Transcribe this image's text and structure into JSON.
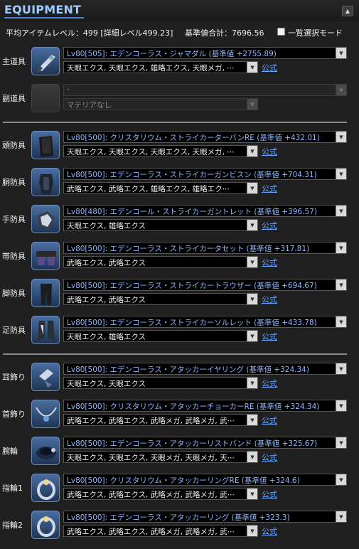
{
  "header": {
    "title": "EQUIPMENT",
    "collapse_glyph": "▲"
  },
  "summary": {
    "avg_level": "平均アイテムレベル：499 [詳細レベル499.23]",
    "total": "基準値合計：7696.56",
    "mode_label": "一覧選択モード",
    "mode_checked": false
  },
  "formal_label": "公式",
  "slots": [
    {
      "label": "主道具",
      "icon": "weapon-gunblade-icon",
      "item": "Lv80[505]: エデンコーラス・ジャマダル (基準値 +2755.89)",
      "materia": "天眼エクス, 天眼エクス, 雄略エクス, 天眼メガ, ⋯",
      "formal": true,
      "disabled": false
    },
    {
      "label": "副道具",
      "icon": "empty-slot-icon",
      "item": "-",
      "materia": "マテリアなし",
      "formal": false,
      "disabled": true
    },
    {
      "label": "頭防具",
      "icon": "head-armor-icon",
      "item": "Lv80[500]: クリスタリウム・ストライカーターバンRE (基準値 +432.01)",
      "materia": "天眼エクス, 天眼エクス, 天眼エクス, 天眼メガ, ⋯",
      "formal": true,
      "disabled": false
    },
    {
      "label": "胴防具",
      "icon": "body-armor-icon",
      "item": "Lv80[500]: エデンコーラス・ストライカーガンビスン (基準値 +704.31)",
      "materia": "武略エクス, 武略エクス, 雄略エクス, 雄略エク⋯",
      "formal": true,
      "disabled": false
    },
    {
      "label": "手防具",
      "icon": "hand-armor-icon",
      "item": "Lv80[480]: エデンコール・ストライカーガントレット (基準値 +396.57)",
      "materia": "天眼エクス, 雄略エクス",
      "formal": true,
      "disabled": false
    },
    {
      "label": "帯防具",
      "icon": "waist-armor-icon",
      "item": "Lv80[500]: エデンコーラス・ストライカータセット (基準値 +317.81)",
      "materia": "武略エクス, 武略エクス",
      "formal": true,
      "disabled": false
    },
    {
      "label": "脚防具",
      "icon": "leg-armor-icon",
      "item": "Lv80[500]: エデンコーラス・ストライカートラウザー (基準値 +694.67)",
      "materia": "武略エクス, 武略エクス",
      "formal": true,
      "disabled": false
    },
    {
      "label": "足防具",
      "icon": "feet-armor-icon",
      "item": "Lv80[500]: エデンコーラス・ストライカーソルレット (基準値 +433.78)",
      "materia": "天眼エクス, 雄略エクス",
      "formal": true,
      "disabled": false
    },
    {
      "label": "耳飾り",
      "icon": "earring-icon",
      "item": "Lv80[500]: エデンコーラス・アタッカーイヤリング (基準値 +324.34)",
      "materia": "天眼エクス, 天眼エクス",
      "formal": true,
      "disabled": false
    },
    {
      "label": "首飾り",
      "icon": "necklace-icon",
      "item": "Lv80[500]: クリスタリウム・アタッカーチョーカーRE (基準値 +324.34)",
      "materia": "武略エクス, 武略エクス, 武略メガ, 武略メガ, 武⋯",
      "formal": true,
      "disabled": false
    },
    {
      "label": "腕輪",
      "icon": "bracelet-icon",
      "item": "Lv80[500]: エデンコーラス・アタッカーリストバンド (基準値 +325.67)",
      "materia": "天眼エクス, 天眼エクス, 天眼メガ, 天眼メガ, 天⋯",
      "formal": true,
      "disabled": false
    },
    {
      "label": "指輪1",
      "icon": "ring-icon",
      "item": "Lv80[500]: クリスタリウム・アタッカーリングRE (基準値 +324.6)",
      "materia": "武略エクス, 武略エクス, 武略メガ, 武略メガ, 武⋯",
      "formal": true,
      "disabled": false
    },
    {
      "label": "指輪2",
      "icon": "ring-icon",
      "item": "Lv80[500]: エデンコーラス・アタッカーリング (基準値 +323.3)",
      "materia": "武略エクス, 武略エクス, 武略メガ, 武略メガ, 武⋯",
      "formal": true,
      "disabled": false
    }
  ],
  "dropdown_glyph": "▼"
}
